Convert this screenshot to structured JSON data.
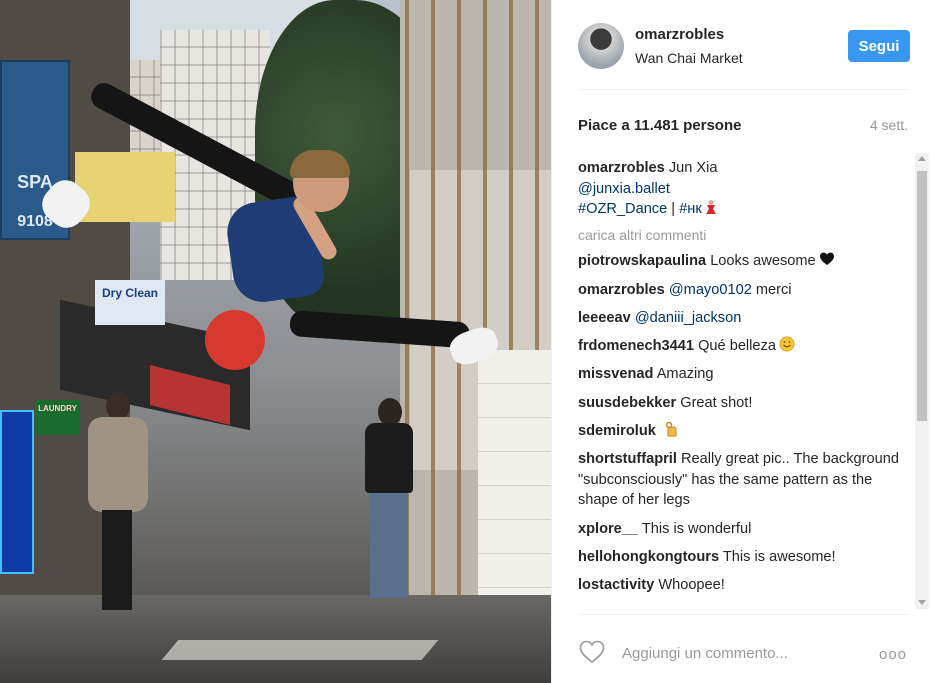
{
  "post": {
    "username": "omarzrobles",
    "location": "Wan Chai Market",
    "follow_label": "Segui",
    "likes_text": "Piace a 11.481 persone",
    "time_ago": "4 sett.",
    "caption": {
      "user": "omarzrobles",
      "line1": "Jun Xia",
      "mention": "@junxia.ballet",
      "tags": "#OZR_Dance",
      "separator": " | ",
      "tag2": "#нк"
    },
    "load_more": "carica altri commenti",
    "comments": [
      {
        "user": "piotrowskapaulina",
        "text": "Looks awesome",
        "emoji": "heart"
      },
      {
        "user": "omarzrobles",
        "mention": "@mayo0102",
        "text": "merci"
      },
      {
        "user": "leeeeav",
        "mention": "@daniii_jackson",
        "text": ""
      },
      {
        "user": "frdomenech3441",
        "text": "Qué belleza",
        "emoji": "smile"
      },
      {
        "user": "missvenad",
        "text": "Amazing"
      },
      {
        "user": "suusdebekker",
        "text": "Great shot!"
      },
      {
        "user": "sdemiroluk",
        "text": "",
        "emoji": "ok-hand"
      },
      {
        "user": "shortstuffapril",
        "text": "Really great pic.. The background \"subconsciously\" has the same pattern as the shape of her legs"
      },
      {
        "user": "xplore__",
        "text": "This is wonderful"
      },
      {
        "user": "hellohongkongtours",
        "text": "This is awesome!"
      },
      {
        "user": "lostactivity",
        "text": "Whoopee!"
      }
    ],
    "add_comment_placeholder": "Aggiungi un commento...",
    "options_label": "ooo"
  },
  "photo": {
    "signs": {
      "dry_clean": "Dry Clean",
      "laundry": "LAUNDRY",
      "spa": "SPA",
      "phone": "9108"
    }
  },
  "colors": {
    "follow_button": "#3897f0",
    "link": "#003569",
    "muted": "#999999"
  }
}
